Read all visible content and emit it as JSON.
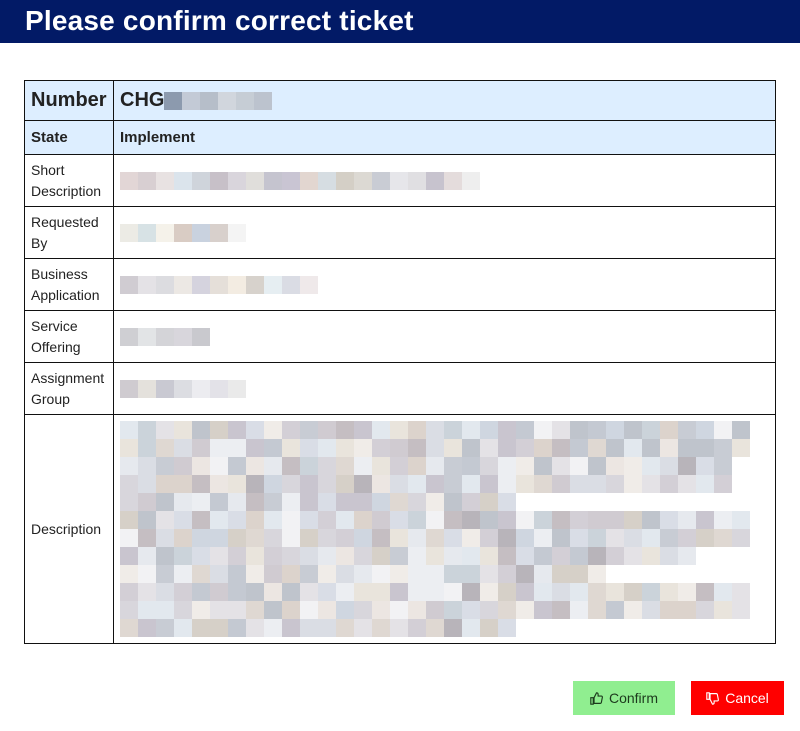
{
  "header": {
    "title": "Please confirm correct ticket"
  },
  "ticket": {
    "number_label": "Number",
    "number_value": "CHG",
    "state_label": "State",
    "state_value": "Implement",
    "fields": [
      {
        "label_line1": "Short",
        "label_line2": "Description"
      },
      {
        "label_line1": "Requested",
        "label_line2": "By"
      },
      {
        "label_line1": "Business",
        "label_line2": "Application"
      },
      {
        "label_line1": "Service",
        "label_line2": "Offering"
      },
      {
        "label_line1": "Assignment",
        "label_line2": "Group"
      }
    ],
    "description_label": "Description"
  },
  "buttons": {
    "confirm_label": "Confirm",
    "cancel_label": "Cancel",
    "confirm_icon": "thumbs-up-icon",
    "cancel_icon": "thumbs-down-icon",
    "confirm_color": "#90ee90",
    "cancel_color": "#ff0000"
  },
  "colors": {
    "title_bar": "#021a66",
    "highlight_row": "#ddeeff"
  }
}
